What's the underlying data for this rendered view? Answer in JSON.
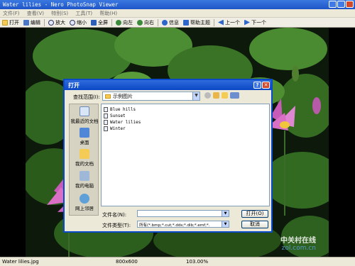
{
  "window": {
    "title": "Water lilies - Nero PhotoSnap Viewer"
  },
  "menu": [
    "文件(F)",
    "查看(V)",
    "特别(S)",
    "工具(T)",
    "帮助(H)"
  ],
  "toolbar": {
    "open": "打开",
    "edit": "编辑",
    "zoom_in": "放大",
    "zoom_out": "缩小",
    "fullscreen": "全屏",
    "rotate_left": "向左",
    "rotate_right": "向右",
    "info": "信息",
    "help_topics": "帮助主题",
    "prev": "上一个",
    "next": "下一个"
  },
  "dialog": {
    "title": "打开",
    "look_in_label": "查找范围(I):",
    "look_in_value": "示例图片",
    "places": [
      "我最近的文档",
      "桌面",
      "我的文档",
      "我的电脑",
      "网上邻居"
    ],
    "files": [
      "Blue hills",
      "Sunset",
      "Water lilies",
      "Winter"
    ],
    "filename_label": "文件名(N):",
    "filename_value": "",
    "filetype_label": "文件类型(T):",
    "filetype_value": "所有(*.bmp;*.cut;*.dds;*.dib;*.emf;*.",
    "open_button": "打开(O)",
    "cancel_button": "取消"
  },
  "status": {
    "filename": "Water lilies.jpg",
    "dimensions": "800x600",
    "zoom": "103.00%"
  },
  "watermark": {
    "line1": "中关村在线",
    "line2": "zol.com.cn"
  }
}
